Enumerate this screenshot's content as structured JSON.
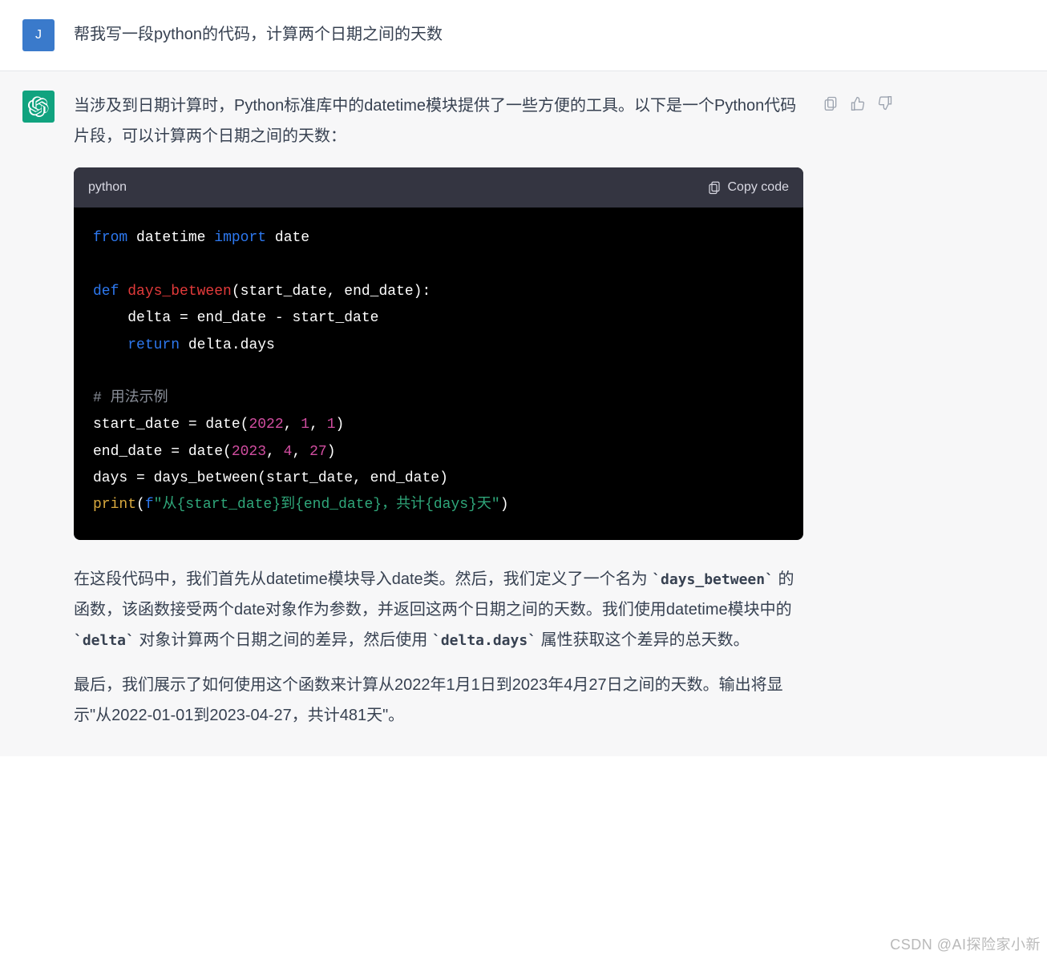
{
  "user": {
    "avatar_letter": "J",
    "text": "帮我写一段python的代码，计算两个日期之间的天数"
  },
  "assistant": {
    "intro": "当涉及到日期计算时，Python标准库中的datetime模块提供了一些方便的工具。以下是一个Python代码片段，可以计算两个日期之间的天数：",
    "code": {
      "language": "python",
      "copy_label": "Copy code",
      "tokens": {
        "from": "from",
        "datetime": "datetime",
        "import": "import",
        "date": "date",
        "def": "def",
        "fn_name": "days_between",
        "params": "(start_date, end_date):",
        "delta_assign": "    delta = end_date - start_date",
        "return": "return",
        "delta_days": "delta.days",
        "comment": "# 用法示例",
        "sd_lhs": "start_date = date(",
        "n2022": "2022",
        "comma_sp": ", ",
        "n1a": "1",
        "n1b": "1",
        "close_paren": ")",
        "ed_lhs": "end_date = date(",
        "n2023": "2023",
        "n4": "4",
        "n27": "27",
        "days_line": "days = days_between(start_date, end_date)",
        "print": "print",
        "open_paren": "(",
        "fprefix": "f",
        "str_body": "\"从{start_date}到{end_date}，共计{days}天\""
      }
    },
    "explain": {
      "p1_a": "在这段代码中，我们首先从datetime模块导入date类。然后，我们定义了一个名为",
      "c1": "`days_between`",
      "p1_b": "的函数，该函数接受两个date对象作为参数，并返回这两个日期之间的天数。我们使用datetime模块中的",
      "c2": "`delta`",
      "p1_c": "对象计算两个日期之间的差异，然后使用",
      "c3": "`delta.days`",
      "p1_d": "属性获取这个差异的总天数。",
      "p2": "最后，我们展示了如何使用这个函数来计算从2022年1月1日到2023年4月27日之间的天数。输出将显示\"从2022-01-01到2023-04-27，共计481天\"。"
    }
  },
  "icons": {
    "clipboard": "clipboard-icon",
    "thumbs_up": "thumbs-up-icon",
    "thumbs_down": "thumbs-down-icon"
  },
  "watermark": "CSDN @AI探险家小新"
}
